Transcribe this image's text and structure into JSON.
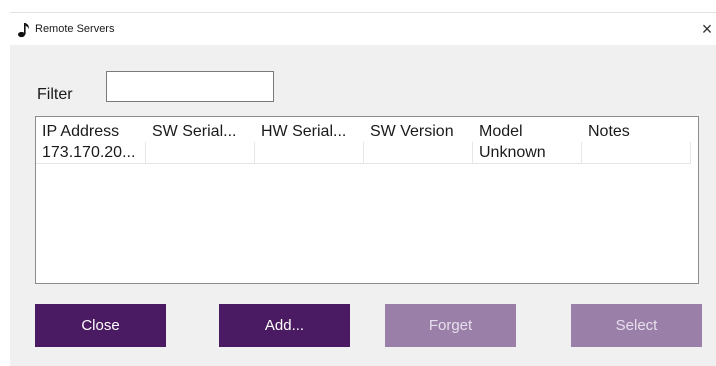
{
  "window": {
    "title": "Remote Servers",
    "close_glyph": "×",
    "icon": "music-note-icon"
  },
  "filter": {
    "label": "Filter",
    "value": ""
  },
  "table": {
    "columns": [
      "IP Address",
      "SW Serial...",
      "HW Serial...",
      "SW Version",
      "Model",
      "Notes"
    ],
    "rows": [
      [
        "173.170.20...",
        "",
        "",
        "",
        "Unknown",
        ""
      ]
    ]
  },
  "buttons": {
    "close": "Close",
    "add": "Add...",
    "forget": "Forget",
    "select": "Select"
  },
  "colors": {
    "accent": "#4a1a62",
    "accent_disabled": "#9a80a8",
    "dialog_bg": "#f0f0f0"
  }
}
